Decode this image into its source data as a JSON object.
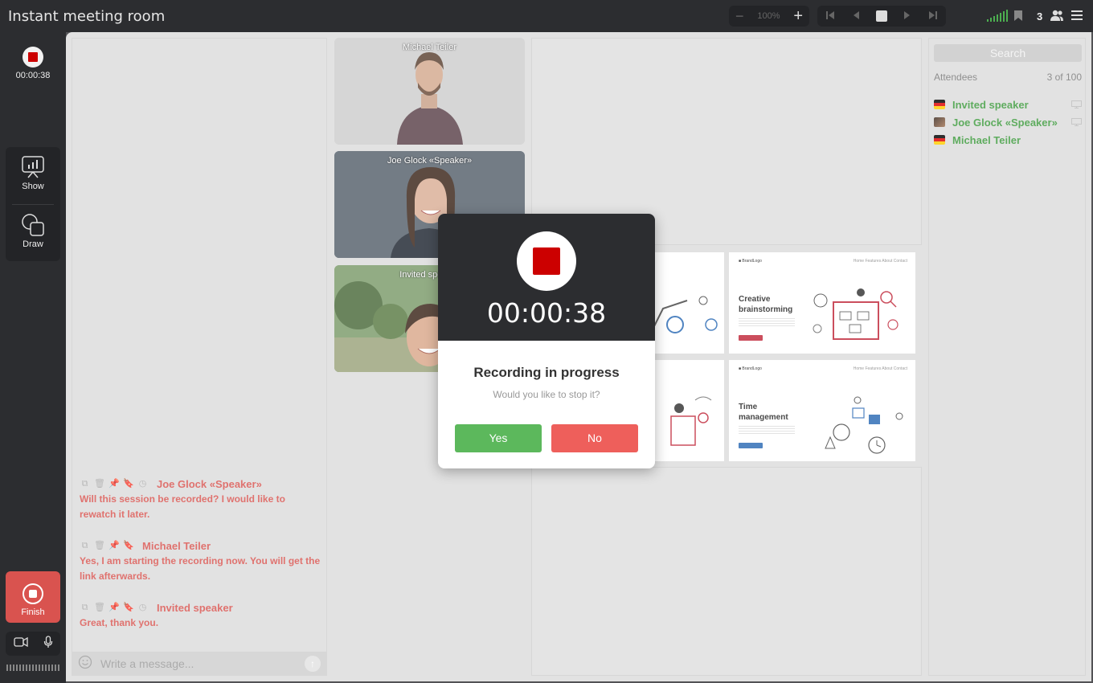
{
  "window": {
    "title": "Instant meeting room"
  },
  "toolbar": {
    "zoom_minus": "−",
    "zoom_value": "100%",
    "zoom_plus": "+",
    "participant_count": "3",
    "signal_color": "#4caf50"
  },
  "left_rail": {
    "recording_time": "00:00:38",
    "show_label": "Show",
    "draw_label": "Draw",
    "finish_label": "Finish"
  },
  "chat": {
    "messages": [
      {
        "author": "Joe Glock «Speaker»",
        "text": "Will this session be recorded? I would like to rewatch it later."
      },
      {
        "author": "Michael Teiler",
        "text": "Yes, I am starting the recording now. You will get the link afterwards."
      },
      {
        "author": "Invited speaker",
        "text": "Great, thank you."
      }
    ],
    "composer_placeholder": "Write a message..."
  },
  "videos": [
    {
      "name": "Michael Teiler"
    },
    {
      "name": "Joe Glock «Speaker»"
    },
    {
      "name": "Invited speaker"
    }
  ],
  "slides": [
    {
      "title": "Creative brainstorming"
    },
    {
      "title": "Time management"
    }
  ],
  "attendees": {
    "search_placeholder": "Search",
    "header_label": "Attendees",
    "count_label": "3 of 100",
    "list": [
      {
        "name": "Invited speaker"
      },
      {
        "name": "Joe Glock «Speaker»"
      },
      {
        "name": "Michael Teiler"
      }
    ]
  },
  "dialog": {
    "time": "00:00:38",
    "title": "Recording in progress",
    "subtitle": "Would you like to stop it?",
    "yes_label": "Yes",
    "no_label": "No"
  },
  "colors": {
    "accent_red": "#d9534f",
    "attendee_green": "#3c9a3c",
    "yes_green": "#5cb85c",
    "no_red": "#ee5f5b"
  }
}
